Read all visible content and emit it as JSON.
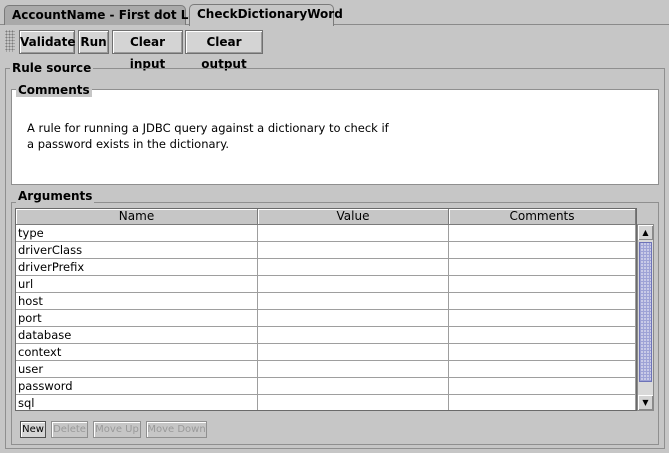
{
  "tabs": [
    {
      "label": "AccountName - First dot Last",
      "active": false
    },
    {
      "label": "CheckDictionaryWord",
      "active": true
    }
  ],
  "toolbar": {
    "validate_label": "Validate",
    "run_label": "Run",
    "clear_input_label": "Clear input",
    "clear_output_label": "Clear output"
  },
  "rule_source": {
    "title": "Rule source",
    "comments_title": "Comments",
    "comments_text_line1": "A rule for running a JDBC query against a dictionary to check if",
    "comments_text_line2": "a password exists in the dictionary.",
    "arguments_title": "Arguments"
  },
  "arguments_table": {
    "columns": [
      "Name",
      "Value",
      "Comments"
    ],
    "rows": [
      {
        "name": "type",
        "value": "",
        "comments": ""
      },
      {
        "name": "driverClass",
        "value": "",
        "comments": ""
      },
      {
        "name": "driverPrefix",
        "value": "",
        "comments": ""
      },
      {
        "name": "url",
        "value": "",
        "comments": ""
      },
      {
        "name": "host",
        "value": "",
        "comments": ""
      },
      {
        "name": "port",
        "value": "",
        "comments": ""
      },
      {
        "name": "database",
        "value": "",
        "comments": ""
      },
      {
        "name": "context",
        "value": "",
        "comments": ""
      },
      {
        "name": "user",
        "value": "",
        "comments": ""
      },
      {
        "name": "password",
        "value": "",
        "comments": ""
      },
      {
        "name": "sql",
        "value": "",
        "comments": ""
      }
    ]
  },
  "table_actions": {
    "new_label": "New",
    "delete_label": "Delete",
    "move_up_label": "Move Up",
    "move_down_label": "Move Down"
  },
  "icons": {
    "scroll_up": "scroll-up-arrow-icon",
    "scroll_down": "scroll-down-arrow-icon",
    "toolbar_grip": "toolbar-grip-icon"
  },
  "colors": {
    "background": "#c6c6c6",
    "scroll_thumb": "#c9cbe7"
  }
}
